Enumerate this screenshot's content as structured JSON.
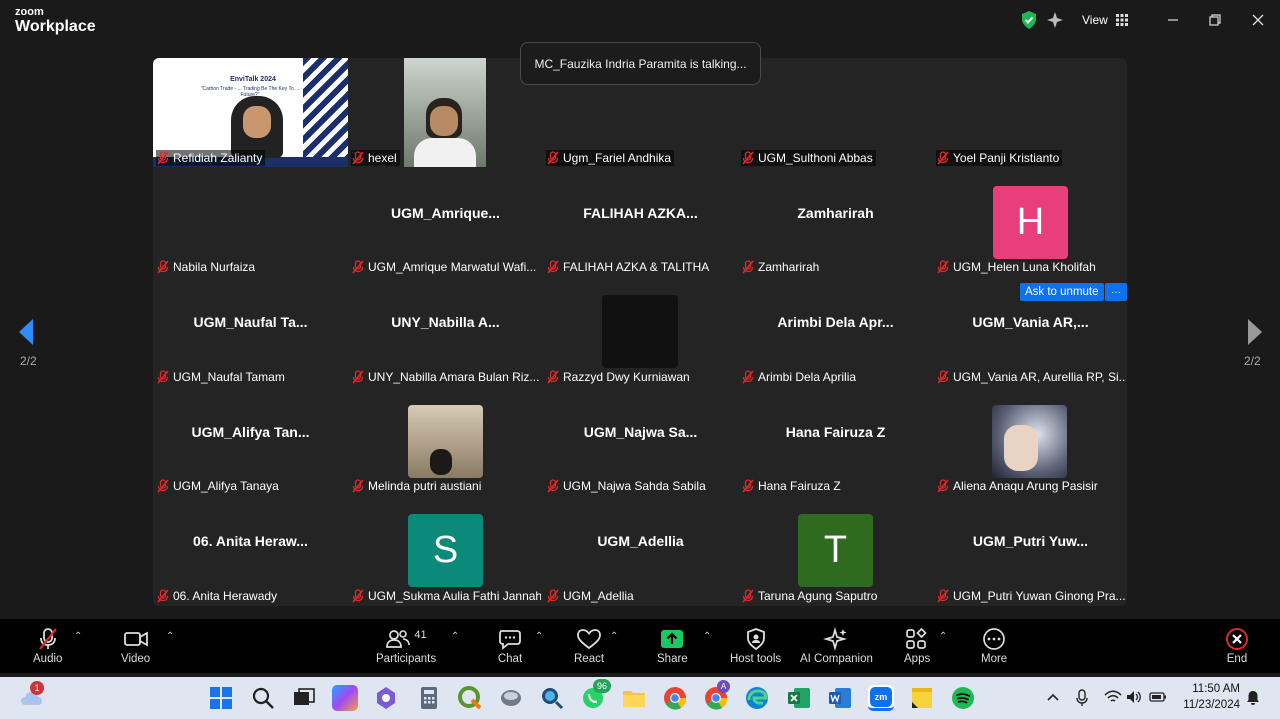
{
  "app": {
    "brand_top": "zoom",
    "brand_bottom": "Workplace",
    "view_label": "View"
  },
  "notification": {
    "talking": "MC_Fauzika Indria Paramita is talking..."
  },
  "gallery": {
    "tiles": [
      {
        "display": "Refidiah Zalianty",
        "name": "Refidiah Zalianty",
        "kind": "slide"
      },
      {
        "display": "hexel",
        "name": "hexel",
        "kind": "video"
      },
      {
        "display": "Ugm_Fariel Andhika",
        "name": "Ugm_Fariel Andhika",
        "kind": "video"
      },
      {
        "display": "UGM_Sulthoni Abbas",
        "name": "UGM_Sulthoni Abbas",
        "kind": "video"
      },
      {
        "display": "Yoel Panji Kristianto",
        "name": "Yoel Panji Kristianto",
        "kind": "video"
      },
      {
        "display": "",
        "name": "Nabila Nurfaiza",
        "kind": "blank"
      },
      {
        "display": "UGM_Amrique...",
        "name": "UGM_Amrique Marwatul Wafi...",
        "kind": "text"
      },
      {
        "display": "FALIHAH AZKA...",
        "name": "FALIHAH AZKA & TALITHA",
        "kind": "text"
      },
      {
        "display": "Zamharirah",
        "name": "Zamharirah",
        "kind": "text"
      },
      {
        "display": "H",
        "name": "UGM_Helen Luna Kholifah",
        "kind": "avatar",
        "color": "#e83e7a"
      },
      {
        "display": "UGM_Naufal Ta...",
        "name": "UGM_Naufal Tamam",
        "kind": "text"
      },
      {
        "display": "UNY_Nabilla A...",
        "name": "UNY_Nabilla Amara Bulan Riz...",
        "kind": "text"
      },
      {
        "display": "",
        "name": "Razzyd Dwy Kurniawan",
        "kind": "black"
      },
      {
        "display": "Arimbi Dela Apr...",
        "name": "Arimbi Dela Aprilia",
        "kind": "text"
      },
      {
        "display": "UGM_Vania AR,...",
        "name": "UGM_Vania AR, Aurellia RP, Si...",
        "kind": "text"
      },
      {
        "display": "UGM_Alifya Tan...",
        "name": "UGM_Alifya Tanaya",
        "kind": "text"
      },
      {
        "display": "",
        "name": "Melinda putri austiani",
        "kind": "photo-room"
      },
      {
        "display": "UGM_Najwa Sa...",
        "name": "UGM_Najwa Sahda Sabila",
        "kind": "text"
      },
      {
        "display": "Hana Fairuza Z",
        "name": "Hana Fairuza Z",
        "kind": "text"
      },
      {
        "display": "",
        "name": "Aliena Anaqu Arung Pasisir",
        "kind": "photo-hand"
      },
      {
        "display": "06. Anita Heraw...",
        "name": "06. Anita Herawady",
        "kind": "text"
      },
      {
        "display": "S",
        "name": "UGM_Sukma Aulia Fathi Jannah",
        "kind": "avatar",
        "color": "#0b8a7a"
      },
      {
        "display": "UGM_Adellia",
        "name": "UGM_Adellia",
        "kind": "text"
      },
      {
        "display": "T",
        "name": "Taruna Agung Saputro",
        "kind": "avatar",
        "color": "#2e6b1e"
      },
      {
        "display": "UGM_Putri Yuw...",
        "name": "UGM_Putri Yuwan Ginong Pra...",
        "kind": "text"
      }
    ],
    "slide_title": "EnviTalk 2024",
    "slide_sub": "\"Carbon Trade - ... Trading Be The Key To ... Future?\"",
    "ask_unmute": "Ask to unmute",
    "more": "···",
    "page_left": "2/2",
    "page_right": "2/2"
  },
  "toolbar": {
    "audio": "Audio",
    "video": "Video",
    "participants": "Participants",
    "participant_count": "41",
    "chat": "Chat",
    "react": "React",
    "share": "Share",
    "host_tools": "Host tools",
    "ai_companion": "AI Companion",
    "apps": "Apps",
    "more": "More",
    "end": "End"
  },
  "taskbar": {
    "weather_badge": "1",
    "whatsapp_badge": "96",
    "chrome_badge": "A",
    "zoom_label": "zm",
    "time": "11:50 AM",
    "date": "11/23/2024"
  },
  "colors": {
    "accent": "#0e72ed",
    "end_red": "#e02828",
    "share_green": "#18c964",
    "muted_mic": "#e02828"
  }
}
